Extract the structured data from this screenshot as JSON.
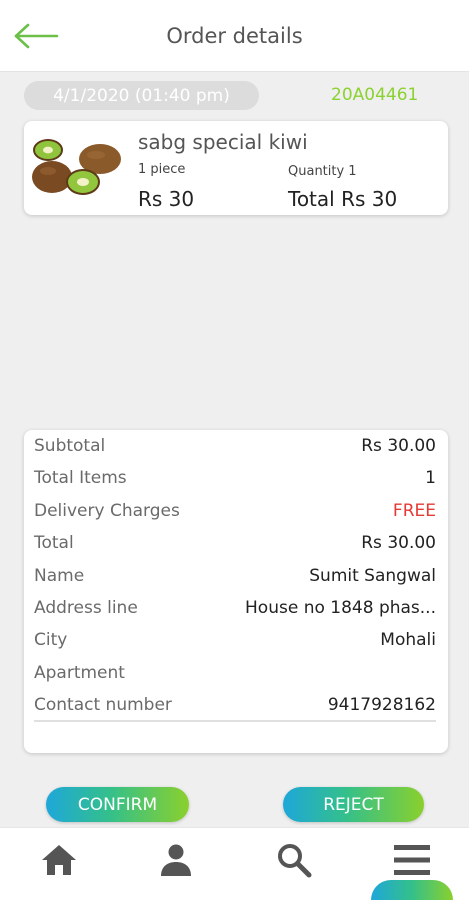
{
  "header": {
    "title": "Order details",
    "back_icon": "arrow-left-icon",
    "accent": "#6cc04a"
  },
  "order": {
    "date": "4/1/2020 (01:40 pm)",
    "id": "20A04461",
    "id_color": "#8cd132"
  },
  "item": {
    "name": "sabg special kiwi",
    "unit": "1 piece",
    "quantity": "Quantity 1",
    "price": "Rs 30",
    "total": "Total Rs 30"
  },
  "summary": {
    "subtotal_label": "Subtotal",
    "subtotal": "Rs 30.00",
    "items_label": "Total Items",
    "items": "1",
    "delivery_label": "Delivery Charges",
    "delivery": "FREE",
    "delivery_color": "#e53935",
    "total_label": "Total",
    "total": "Rs 30.00",
    "name_label": "Name",
    "name": "Sumit Sangwal",
    "address_label": "Address line",
    "address": "House no 1848 phas...",
    "city_label": "City",
    "city": "Mohali",
    "apartment_label": "Apartment",
    "apartment": "",
    "contact_label": "Contact number",
    "contact": "9417928162"
  },
  "actions": {
    "confirm": "CONFIRM",
    "reject": "REJECT"
  },
  "nav": {
    "icons": [
      "home-icon",
      "person-icon",
      "search-icon",
      "menu-icon"
    ]
  }
}
